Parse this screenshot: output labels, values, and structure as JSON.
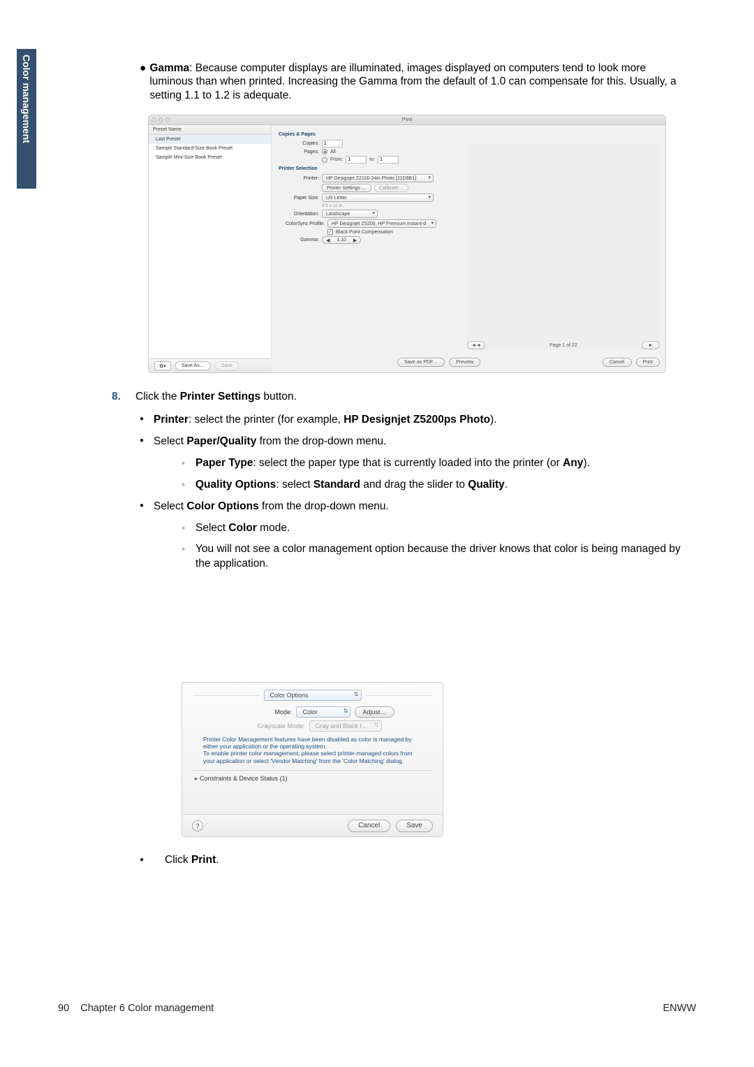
{
  "sidetab": "Color management",
  "top_bullet": {
    "label": "Gamma",
    "text": ": Because computer displays are illuminated, images displayed on computers tend to look more luminous than when printed. Increasing the Gamma from the default of 1.0 can compensate for this. Usually, a setting 1.1 to 1.2 is adequate."
  },
  "shot1": {
    "window_title": "Print",
    "preset_header": "Preset Name",
    "presets": [
      "Last Preset",
      "Sample Standard-Size Book Preset",
      "Sample Mini-Size Book Preset"
    ],
    "gear": "✿▾",
    "save_as": "Save As…",
    "save": "Save",
    "section_copies": "Copies & Pages",
    "copies_label": "Copies:",
    "copies_value": "1",
    "pages_label": "Pages:",
    "pages_all": "All",
    "pages_from": "From:",
    "from_value": "1",
    "to_label": "to:",
    "to_value": "1",
    "section_printer": "Printer Selection",
    "printer_label": "Printer:",
    "printer_value": "HP Designjet Z2100 24in Photo [21D9B1]",
    "printer_settings": "Printer Settings …",
    "calibrate": "Calibrate…",
    "paper_size_label": "Paper Size:",
    "paper_size_value": "US Letter",
    "paper_dims": "8.5         x  11           in.",
    "orientation_label": "Orientation:",
    "orientation_value": "Landscape",
    "colorsync_label": "ColorSync Profile:",
    "colorsync_value": "HP Designjet Z5200, HP Premium Instant-d",
    "bpc": "Black Point Compensation",
    "gamma_label": "Gamma:",
    "gamma_value": "1.10",
    "page_indicator": "Page 1 of 22",
    "prev": "◄◄",
    "next": "►",
    "save_pdf": "Save as PDF…",
    "preview": "Preview",
    "cancel": "Cancel",
    "print": "Print"
  },
  "step_num": "8.",
  "step_text_a": "Click the ",
  "step_text_b": "Printer Settings",
  "step_text_c": " button.",
  "lv1": {
    "printer": {
      "b": "Printer",
      "t": ": select the printer (for example, ",
      "b2": "HP Designjet Z5200ps Photo",
      "t2": ")."
    },
    "pq_a": "Select ",
    "pq_b": "Paper/Quality",
    "pq_c": " from the drop-down menu.",
    "pt": {
      "b": "Paper Type",
      "t": ": select the paper type that is currently loaded into the printer (or ",
      "b2": "Any",
      "t2": ")."
    },
    "qo": {
      "b": "Quality Options",
      "t": ": select ",
      "b2": "Standard",
      "t2": " and drag the slider to ",
      "b3": "Quality",
      "t3": "."
    },
    "co_a": "Select ",
    "co_b": "Color Options",
    "co_c": " from the drop-down menu.",
    "col": {
      "a": "Select ",
      "b": "Color",
      "c": " mode."
    },
    "note": "You will not see a color management option because the driver knows that color is being managed by the application."
  },
  "shot2": {
    "section": "Color Options",
    "mode_label": "Mode:",
    "mode_value": "Color",
    "adjust": "Adjust…",
    "gray_label": "Grayscale Mode:",
    "gray_value": "Gray and Black I…",
    "note": "Printer Color Management features have been disabled as color is managed by either your application or the operating system.\nTo enable printer color management, please select printer-managed colors from your application or select 'Vendor Matching' from the 'Color Matching' dialog.",
    "constraints": "Constraints & Device Status (1)",
    "help": "?",
    "cancel": "Cancel",
    "save": "Save"
  },
  "final_a": "Click ",
  "final_b": "Print",
  "final_c": ".",
  "footer": {
    "left_page": "90",
    "left_chapter": "Chapter 6   Color management",
    "right": "ENWW"
  }
}
